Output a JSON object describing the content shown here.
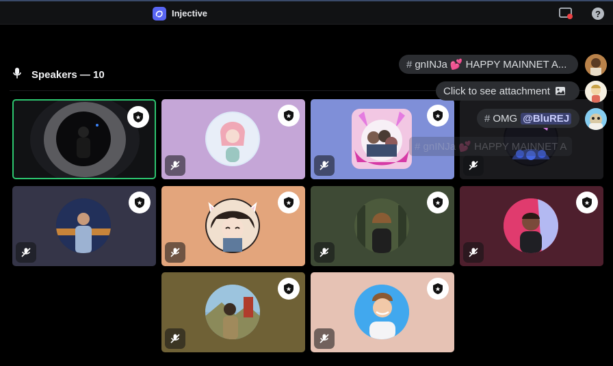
{
  "app": {
    "title": "Injective"
  },
  "stage": {
    "title": "Speakers — 10"
  },
  "tiles": [
    {
      "bg": "#111214",
      "speaking": true
    },
    {
      "bg": "#c5a6d7"
    },
    {
      "bg": "#7f8fd8"
    },
    {
      "bg": "#1a1a1d"
    },
    {
      "bg": "#353548"
    },
    {
      "bg": "#e3a57c"
    },
    {
      "bg": "#3e4a35"
    },
    {
      "bg": "#4e1f2d"
    },
    {
      "bg": "#6f6136"
    },
    {
      "bg": "#e6c2b4"
    }
  ],
  "toasts": [
    {
      "channel": "gnINJa",
      "emoji": "💕",
      "text": "HAPPY MAINNET A..."
    },
    {
      "text": "Click to see attachment"
    },
    {
      "channel": "OMG",
      "mention": "@BluREJ"
    }
  ],
  "ghost": {
    "channel": "gnINJa",
    "text": "HAPPY MAINNET A"
  },
  "colors": {
    "speaking_ring": "#2dc770",
    "badge_bg": "#ffffff",
    "mention_bg": "#3c4270"
  },
  "icons": [
    "injective-logo-icon",
    "screen-share-icon",
    "help-icon",
    "microphone-icon",
    "moderator-badge-icon",
    "muted-mic-icon",
    "image-icon"
  ]
}
